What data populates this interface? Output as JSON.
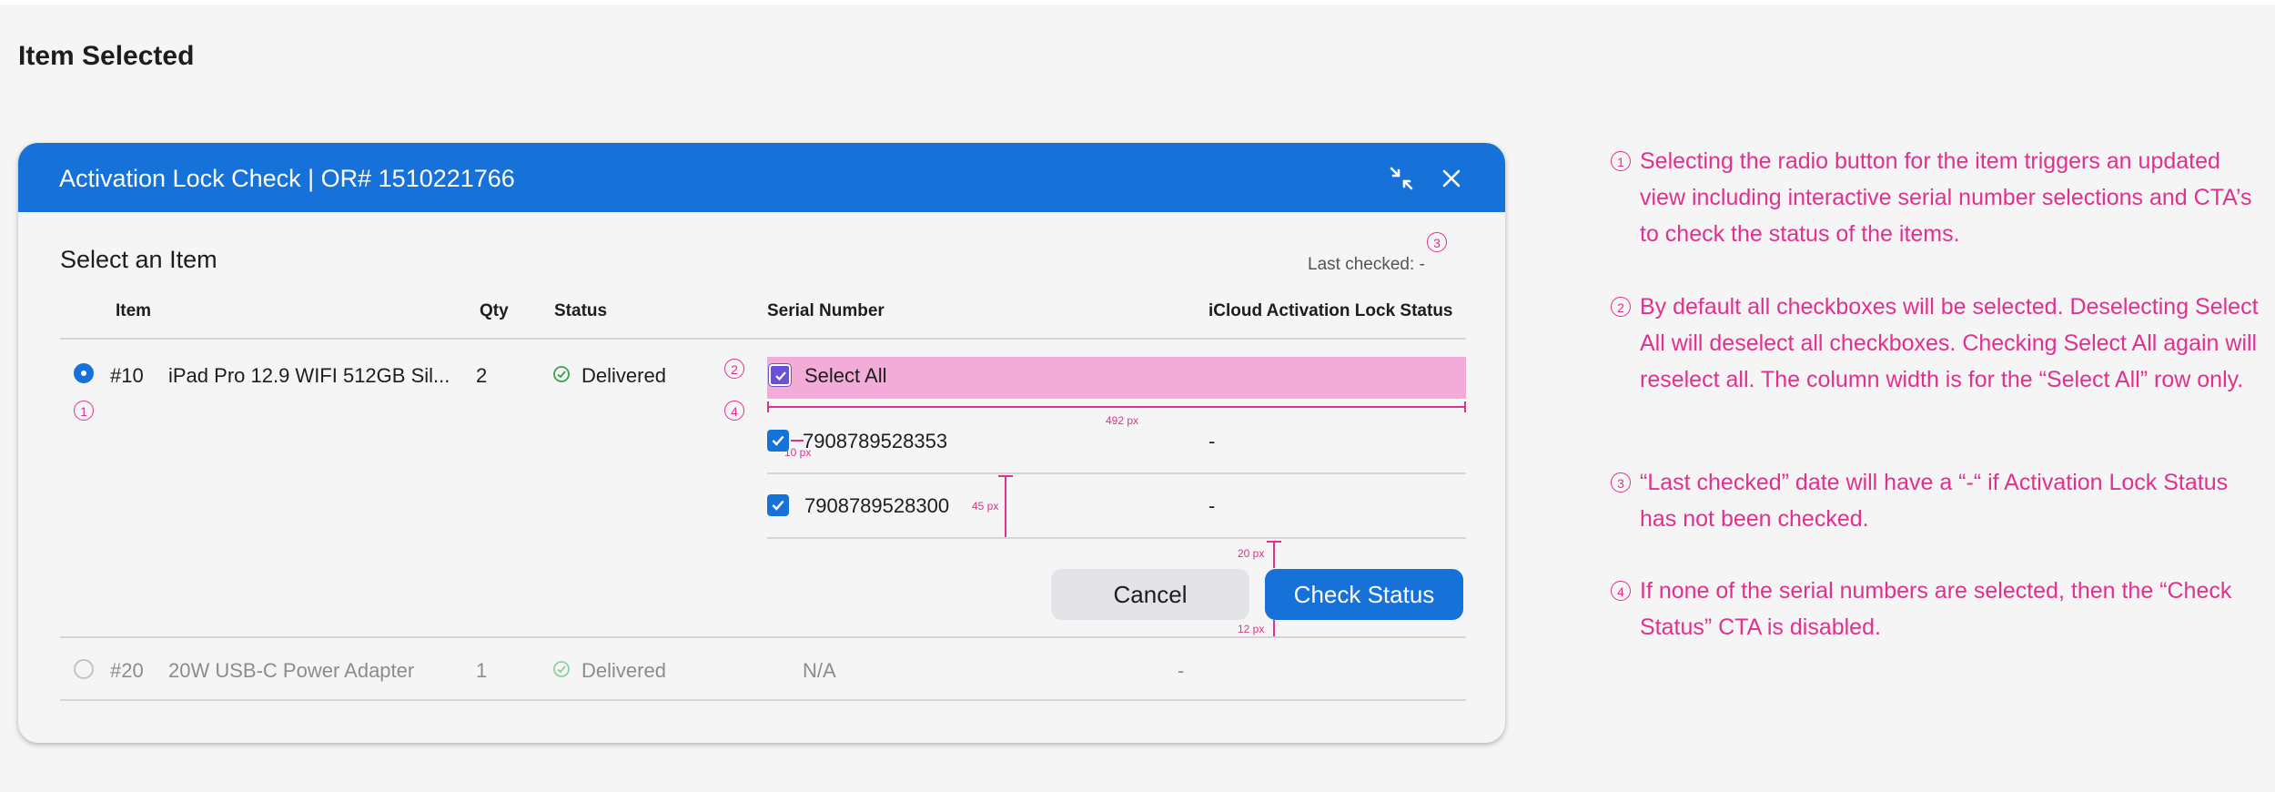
{
  "page": {
    "title": "Item Selected"
  },
  "dialog": {
    "title": "Activation Lock Check | OR# 1510221766",
    "section_title": "Select an Item",
    "last_checked": "Last checked: -",
    "columns": {
      "item": "Item",
      "qty": "Qty",
      "status": "Status",
      "serial": "Serial Number",
      "icloud": "iCloud Activation Lock Status"
    },
    "items": [
      {
        "num": "#10",
        "name": "iPad Pro 12.9 WIFI 512GB Sil...",
        "qty": "2",
        "status": "Delivered",
        "selected": true
      },
      {
        "num": "#20",
        "name": "20W USB-C Power Adapter",
        "qty": "1",
        "status": "Delivered",
        "selected": false,
        "serial": "N/A",
        "icloud": "-"
      }
    ],
    "select_all": {
      "label": "Select All",
      "checked": true
    },
    "serials": [
      {
        "number": "7908789528353",
        "lock_status": "-",
        "checked": true
      },
      {
        "number": "7908789528300",
        "lock_status": "-",
        "checked": true
      }
    ],
    "buttons": {
      "cancel": "Cancel",
      "check_status": "Check Status"
    }
  },
  "annotations": {
    "markers": [
      "1",
      "2",
      "3",
      "4"
    ],
    "measurements": {
      "select_all_width": "492 px",
      "checkbox_gap": "10 px",
      "row_height": "45 px",
      "button_top_gap": "20 px",
      "button_bottom_gap": "12 px"
    },
    "notes": [
      {
        "num": "1",
        "text": "Selecting the radio button for the item triggers an updated view including interactive serial number selections and CTA’s to check the status of the items."
      },
      {
        "num": "2",
        "text": "By default all checkboxes will be selected. Deselecting Select All will deselect all checkboxes. Checking Select All again will reselect all. The column width is for the “Select All” row only."
      },
      {
        "num": "3",
        "text": "“Last checked” date will have a “-“ if Activation Lock Status has not been checked."
      },
      {
        "num": "4",
        "text": "If none of the serial numbers are selected, then the “Check Status” CTA is disabled."
      }
    ]
  },
  "colors": {
    "primary": "#1672d9",
    "annotation": "#e0318f",
    "highlight": "#f2acd7",
    "checkbox_selected_all": "#6a50d3"
  },
  "icons": {
    "minimize": "minimize-arrows-icon",
    "close": "close-icon",
    "status": "check-circle-icon"
  }
}
